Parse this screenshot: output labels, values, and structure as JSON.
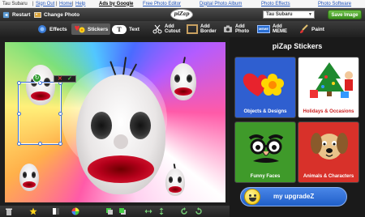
{
  "topbar": {
    "user": "Tau Subaru",
    "signout": "Sign Out",
    "home": "Home",
    "help": "Help",
    "ads": "Ads by Google",
    "link1": "Free Photo Editor",
    "link2": "Digital Photo Album",
    "link3": "Photo Effects",
    "link4": "Photo Software"
  },
  "toolbar1": {
    "restart": "Restart",
    "change_photo": "Change Photo",
    "logo": "piZap",
    "photo_select": "Tau Subaru",
    "save": "Save Image"
  },
  "tools": [
    {
      "label": "Effects"
    },
    {
      "label": "Stickers"
    },
    {
      "label": "Text"
    },
    {
      "line1": "Add",
      "line2": "Cutout"
    },
    {
      "line1": "Add",
      "line2": "Border"
    },
    {
      "line1": "Add",
      "line2": "Photo"
    },
    {
      "line1": "Add",
      "line2": "MEME"
    },
    {
      "label": "Paint"
    }
  ],
  "meme_badge": "MEME",
  "text_icon": "T",
  "selection": {
    "close": "✕",
    "confirm": "✓"
  },
  "panel": {
    "title": "piZap Stickers",
    "categories": [
      {
        "label": "Objects & Designs",
        "color": "#2f5fd0"
      },
      {
        "label": "Holidays & Occasions",
        "color": "#ffffff"
      },
      {
        "label": "Funny Faces",
        "color": "#3f9a2a"
      },
      {
        "label": "Animals & Characters",
        "color": "#d8312a"
      }
    ],
    "upgrade": "my upgradeZ"
  },
  "colors": {
    "accent": "#3b8f1f",
    "selection": "#3b6ed4"
  }
}
